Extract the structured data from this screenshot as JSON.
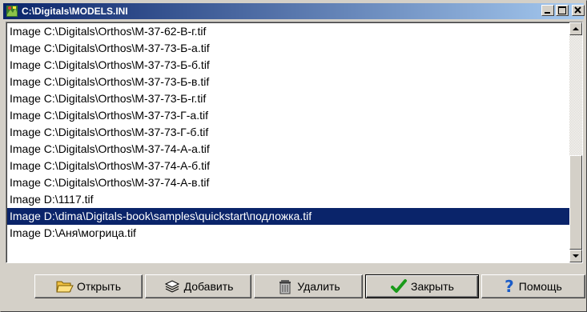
{
  "window": {
    "title": "C:\\Digitals\\MODELS.INI",
    "controls": {
      "minimize": "minimize-button",
      "maximize": "maximize-button",
      "close": "close-button"
    }
  },
  "list": {
    "items": [
      "Image C:\\Digitals\\Orthos\\M-37-62-В-г.tif",
      "Image C:\\Digitals\\Orthos\\M-37-73-Б-а.tif",
      "Image C:\\Digitals\\Orthos\\M-37-73-Б-б.tif",
      "Image C:\\Digitals\\Orthos\\M-37-73-Б-в.tif",
      "Image C:\\Digitals\\Orthos\\M-37-73-Б-г.tif",
      "Image C:\\Digitals\\Orthos\\M-37-73-Г-а.tif",
      "Image C:\\Digitals\\Orthos\\M-37-73-Г-б.tif",
      "Image C:\\Digitals\\Orthos\\M-37-74-А-а.tif",
      "Image C:\\Digitals\\Orthos\\M-37-74-А-б.tif",
      "Image C:\\Digitals\\Orthos\\M-37-74-А-в.tif",
      "Image D:\\1117.tif",
      "Image D:\\dima\\Digitals-book\\samples\\quickstart\\подложка.tif",
      "Image D:\\Аня\\могрица.tif"
    ],
    "selected_index": 11
  },
  "buttons": {
    "open": "Открыть",
    "add": "Добавить",
    "delete": "Удалить",
    "close": "Закрыть",
    "help": "Помощь"
  },
  "colors": {
    "selection": "#0a246a",
    "titlebar_start": "#0a246a",
    "titlebar_end": "#a6caf0",
    "face": "#d4d0c8",
    "check_green": "#1a9a1a",
    "help_blue": "#1a5cc8"
  }
}
